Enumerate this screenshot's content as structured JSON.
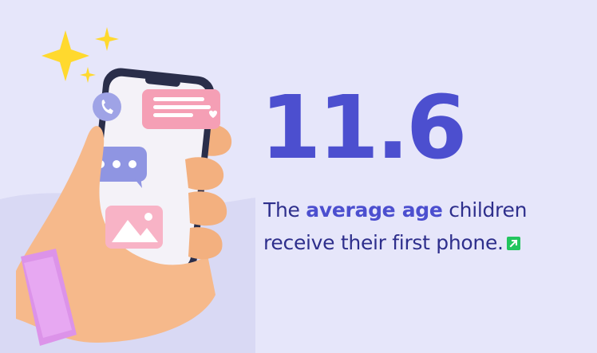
{
  "stat": {
    "value": "11.6"
  },
  "caption": {
    "part1": "The ",
    "highlight": "average age",
    "part2": " children receive their first phone."
  },
  "colors": {
    "background": "#e6e6fa",
    "accent": "#4c4fcf",
    "text": "#2e2f8c",
    "link_badge": "#22c55e"
  },
  "icons": {
    "link": "external-link-icon",
    "illustration": "hand-holding-phone-illustration"
  }
}
